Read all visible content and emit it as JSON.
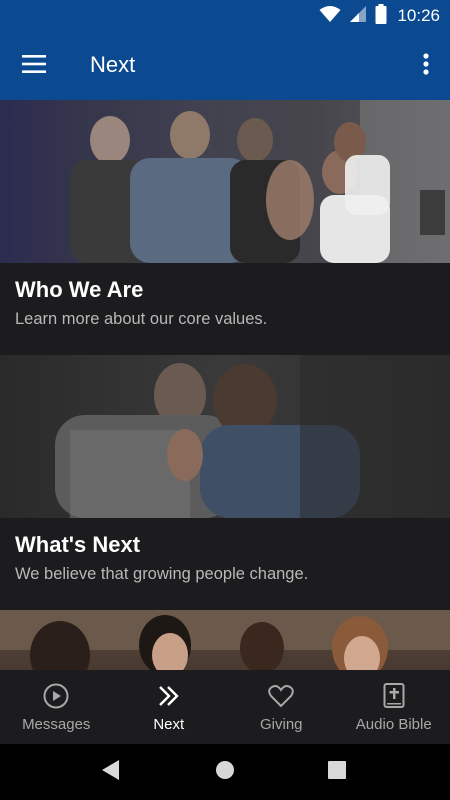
{
  "status_bar": {
    "time": "10:26"
  },
  "app_bar": {
    "title": "Next"
  },
  "cards": [
    {
      "title": "Who We Are",
      "subtitle": "Learn more about our core values."
    },
    {
      "title": "What's Next",
      "subtitle": "We believe that growing people change."
    },
    {
      "title": "",
      "subtitle": ""
    }
  ],
  "bottom_nav": {
    "items": [
      {
        "label": "Messages",
        "icon": "play-circle-icon",
        "active": false
      },
      {
        "label": "Next",
        "icon": "double-chevron-right-icon",
        "active": true
      },
      {
        "label": "Giving",
        "icon": "heart-icon",
        "active": false
      },
      {
        "label": "Audio Bible",
        "icon": "bible-icon",
        "active": false
      }
    ]
  },
  "colors": {
    "primary": "#0b4991",
    "card_body": "#1c1c1e",
    "nav_background": "#1c1c1e",
    "inactive": "#a8a8a8"
  }
}
